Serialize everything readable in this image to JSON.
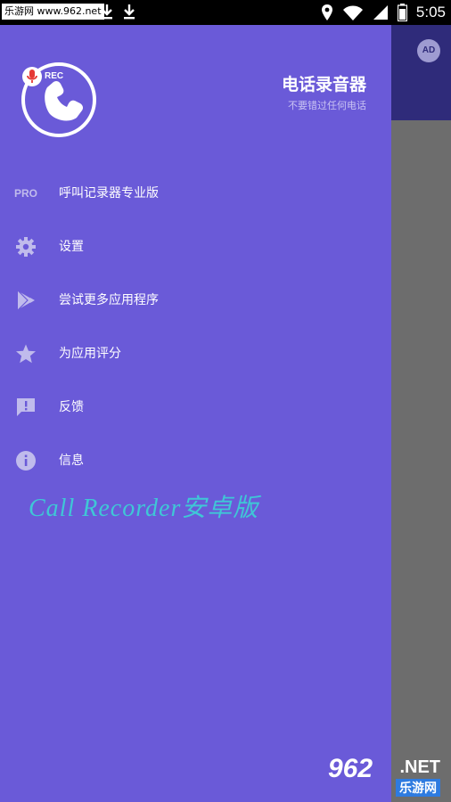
{
  "status_bar": {
    "watermark": "乐游网 www.962.net",
    "time": "5:05"
  },
  "ad_badge": "AD",
  "header": {
    "logo_text": "REC",
    "title": "电话录音器",
    "subtitle": "不要错过任何电话"
  },
  "menu": {
    "items": [
      {
        "icon": "pro-text",
        "icon_text": "PRO",
        "label": "呼叫记录器专业版"
      },
      {
        "icon": "gear-icon",
        "label": "设置"
      },
      {
        "icon": "play-store-icon",
        "label": "尝试更多应用程序"
      },
      {
        "icon": "star-icon",
        "label": "为应用评分"
      },
      {
        "icon": "feedback-icon",
        "label": "反馈"
      },
      {
        "icon": "info-icon",
        "label": "信息"
      }
    ]
  },
  "promo_text": "Call Recorder安卓版",
  "corner_watermark": {
    "number": "962",
    "domain": ".NET",
    "site": "乐游网"
  },
  "colors": {
    "drawer": "#6a5ad8",
    "header_dark": "#2f2b7a",
    "scrim": "#6d6d6d",
    "promo": "#3fc7d6"
  }
}
